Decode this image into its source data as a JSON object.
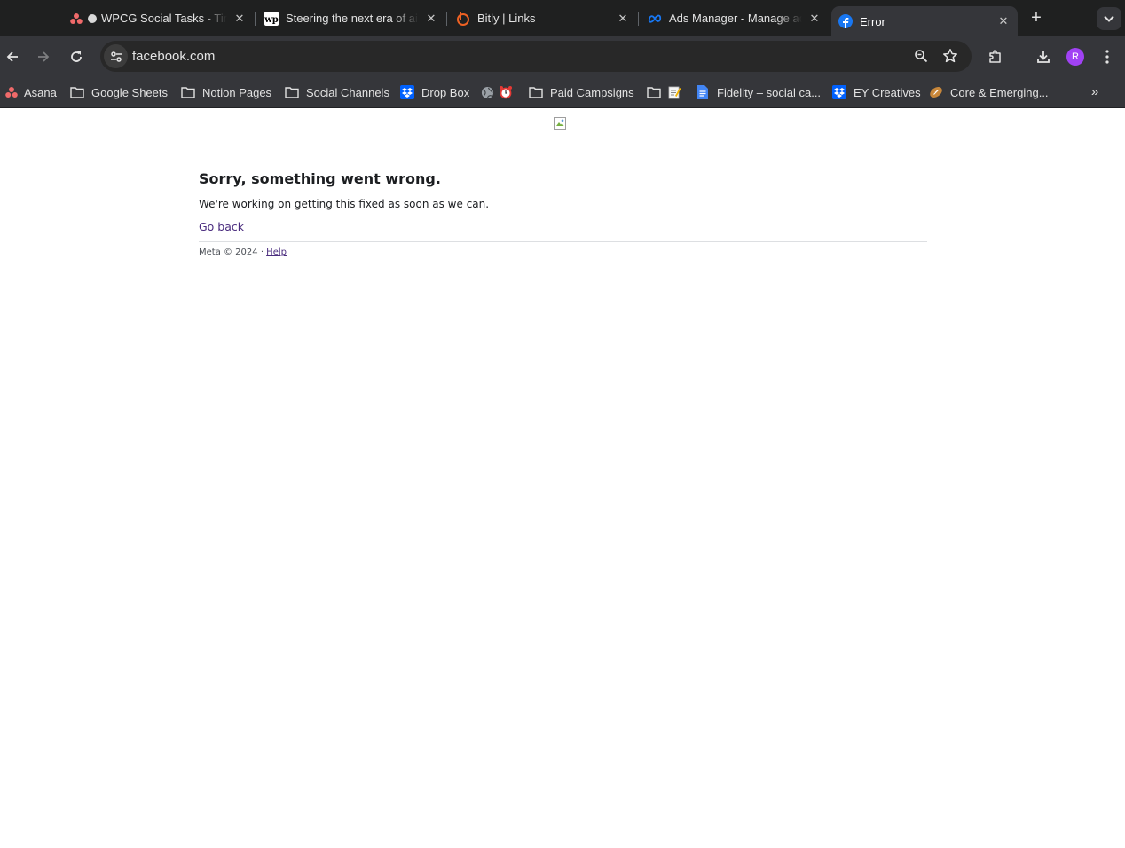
{
  "tabs": [
    {
      "title": "WPCG Social Tasks - Timeline",
      "favicon": "asana-icon",
      "close": "✕"
    },
    {
      "title": "Steering the next era of ai",
      "favicon": "washington-post-icon",
      "close": "✕"
    },
    {
      "title": "Bitly | Links",
      "favicon": "bitly-icon",
      "close": "✕"
    },
    {
      "title": "Ads Manager - Manage ads",
      "favicon": "meta-icon",
      "close": "✕"
    },
    {
      "title": "Error",
      "favicon": "facebook-icon",
      "close": "✕",
      "active": true
    }
  ],
  "new_tab_label": "+",
  "address_bar": {
    "url": "facebook.com"
  },
  "profile": {
    "initial": "R",
    "color": "#a142f4"
  },
  "bookmarks": [
    {
      "label": "Asana",
      "icon": "asana-icon"
    },
    {
      "label": "Google Sheets",
      "icon": "folder-icon"
    },
    {
      "label": "Notion Pages",
      "icon": "folder-icon"
    },
    {
      "label": "Social Channels",
      "icon": "folder-icon"
    },
    {
      "label": "Drop Box",
      "icon": "dropbox-icon"
    },
    {
      "label": "",
      "icon": "globe-icon"
    },
    {
      "label": "",
      "icon": "alarm-clock-icon"
    },
    {
      "label": "Paid Campsigns",
      "icon": "folder-icon"
    },
    {
      "label": "",
      "icon": "folder-icon"
    },
    {
      "label": "",
      "icon": "memo-icon"
    },
    {
      "label": "Fidelity – social ca...",
      "icon": "google-docs-icon"
    },
    {
      "label": "EY Creatives",
      "icon": "dropbox-icon"
    },
    {
      "label": "Core & Emerging...",
      "icon": "football-icon"
    }
  ],
  "bookmarks_overflow": "»",
  "error_page": {
    "heading": "Sorry, something went wrong.",
    "message": "We're working on getting this fixed as soon as we can.",
    "go_back": "Go back",
    "footer_text": "Meta © 2024 · ",
    "help_link": "Help"
  },
  "colors": {
    "tab_strip": "#1f2020",
    "toolbar": "#35363a",
    "link_visited": "#4b2d7f"
  }
}
